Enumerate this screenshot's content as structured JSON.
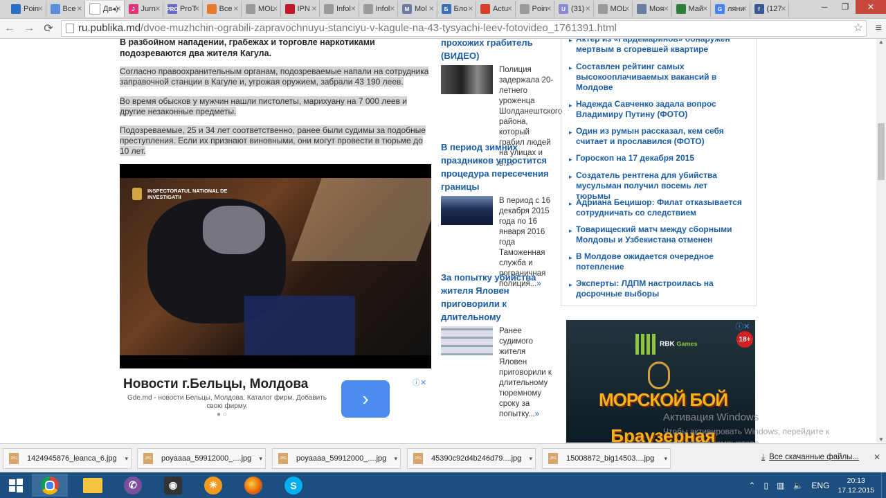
{
  "browser": {
    "tabs": [
      {
        "label": "Poin",
        "fav_color": "#2a6fc9",
        "fav_text": ""
      },
      {
        "label": "Все",
        "fav_color": "#5b8dd6",
        "fav_text": ""
      },
      {
        "label": "Дв",
        "fav_color": "#ffffff",
        "fav_text": "",
        "active": true
      },
      {
        "label": "Jurn",
        "fav_color": "#e0337a",
        "fav_text": "J"
      },
      {
        "label": "ProT",
        "fav_color": "#6a6acb",
        "fav_text": "PRO"
      },
      {
        "label": "Все",
        "fav_color": "#e87a2e",
        "fav_text": ""
      },
      {
        "label": "MOL",
        "fav_color": "#9a9a9a",
        "fav_text": ""
      },
      {
        "label": "IPN",
        "fav_color": "#c0192c",
        "fav_text": ""
      },
      {
        "label": "Infol",
        "fav_color": "#9a9a9a",
        "fav_text": ""
      },
      {
        "label": "Infol",
        "fav_color": "#9a9a9a",
        "fav_text": ""
      },
      {
        "label": "Mol",
        "fav_color": "#6f7da5",
        "fav_text": "M"
      },
      {
        "label": "Бло",
        "fav_color": "#3b6fb6",
        "fav_text": "Б"
      },
      {
        "label": "Actu",
        "fav_color": "#d6402a",
        "fav_text": ""
      },
      {
        "label": "Poin",
        "fav_color": "#9a9a9a",
        "fav_text": ""
      },
      {
        "label": "(31)",
        "fav_color": "#8a8ad0",
        "fav_text": "U"
      },
      {
        "label": "MOL",
        "fav_color": "#9a9a9a",
        "fav_text": ""
      },
      {
        "label": "Моя",
        "fav_color": "#6a7fa0",
        "fav_text": ""
      },
      {
        "label": "Май",
        "fav_color": "#2f7f3a",
        "fav_text": ""
      },
      {
        "label": "ляни",
        "fav_color": "#4285f4",
        "fav_text": "G"
      },
      {
        "label": "(127",
        "fav_color": "#3b5998",
        "fav_text": "f"
      }
    ],
    "url_host": "ru.publika.md",
    "url_path": "/dvoe-muzhchin-ograbili-zapravochnuyu-stanciyu-v-kagule-na-43-tysyachi-leev-fotovideo_1761391.html"
  },
  "article": {
    "lead": "В разбойном нападении, грабежах и торговле наркотиками подозреваются два жителя Кагула.",
    "p1": "Согласно правоохранительным органам, подозреваемые напали на сотрудника заправочной станции в Кагуле и, угрожая оружием, забрали 43 190 леев.",
    "p2": "Во время обысков у мужчин нашли пистолеты, марихуану на 7 000 леев и другие незаконные предметы.",
    "p3": "Подозреваемые, 25 и 34 лет соответственно, ранее были судимы за подобные преступления. Если их признают виновными, они могут провести в тюрьме до 10 лет.",
    "video_logo_text": "INSPECTORATUL NATIONAL DE INVESTIGATII"
  },
  "ad_left": {
    "title": "Новости г.Бельцы, Молдова",
    "desc": "Gde.md - новости Бельцы, Молдова. Каталог фирм. Добавить свою фирму.",
    "button_glyph": "›",
    "dots": "● ○"
  },
  "middle_news": [
    {
      "title": "прохожих грабитель (ВИДЕО)",
      "text": "Полиция задержала 20-летнего уроженца Шолданештского района, который грабил людей на улицах и в...",
      "more": "»"
    },
    {
      "title": "В период зимних праздников упростится процедура пересечения границы",
      "text": "В период с 16 декабря 2015 года по 16 января 2016 года Таможенная служба и пограничная полиция...",
      "more": "»"
    },
    {
      "title": "За попытку убийства жителя Яловен приговорили к длительному",
      "text": "Ранее судимого жителя Яловен приговорили к длительному тюремному сроку за попытку...",
      "more": "»"
    }
  ],
  "right_news": [
    "Актер из «Гардемаринов» обнаружен мертвым в сгоревшей квартире",
    "Составлен рейтинг самых высокооплачиваемых вакансий в Молдове",
    "Надежда Савченко задала вопрос Владимиру Путину (ФОТО)",
    "Один из румын рассказал, кем себя считает и прославился (ФОТО)",
    "Гороскоп на 17 декабря 2015",
    "Создатель рентгена для убийства мусульман получил восемь лет тюрьмы",
    "Адриана Бецишор: Филат отказывается сотрудничать со следствием",
    "Товарищеский матч между сборными Молдовы и Узбекистана отменен",
    "В Молдове ожидается очередное потепление",
    "Эксперты: ЛДПМ настроилась на досрочные выборы"
  ],
  "ad_right": {
    "brand": "RBK",
    "brand_sub": "Games",
    "age": "18+",
    "title1": "МОРСКОЙ БОЙ",
    "title2": "Браузерная"
  },
  "windows_activation": {
    "line1": "Активация Windows",
    "line2": "Чтобы активировать Windows, перейдите к параметрам компьютера."
  },
  "downloads": {
    "items": [
      "1424945876_leanca_6.jpg",
      "poyaaaa_59912000_....jpg",
      "poyaaaa_59912000_....jpg",
      "45390c92d4b246d79....jpg",
      "15008872_big14503....jpg"
    ],
    "icon_text": "JPG",
    "all_label": "Все скачанные файлы..."
  },
  "taskbar": {
    "lang": "ENG",
    "time": "20:13",
    "date": "17.12.2015"
  }
}
